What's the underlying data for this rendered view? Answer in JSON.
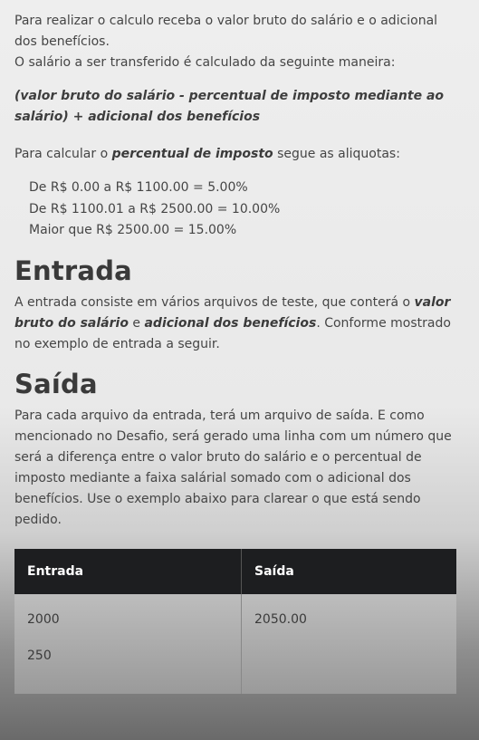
{
  "intro": {
    "line1": "Para realizar o calculo receba o valor bruto do salário e o adicional dos benefícios.",
    "line2": "O salário a ser transferido é calculado da seguinte maneira:",
    "formula": "(valor bruto do salário - percentual de imposto mediante ao salário) + adicional dos benefícios",
    "calc_prefix": "Para calcular o ",
    "calc_bold": "percentual de imposto",
    "calc_suffix": " segue as aliquotas:",
    "rates": [
      "De R$ 0.00 a R$ 1100.00 = 5.00%",
      "De R$ 1100.01 a R$ 2500.00 = 10.00%",
      "Maior que R$ 2500.00 = 15.00%"
    ]
  },
  "entrada": {
    "heading": "Entrada",
    "text_prefix": "A entrada consiste em vários arquivos de teste, que conterá o ",
    "bold1": "valor bruto do salário",
    "text_mid": " e ",
    "bold2": "adicional dos benefícios",
    "text_suffix": ". Conforme mostrado no exemplo de entrada a seguir."
  },
  "saida": {
    "heading": "Saída",
    "text": "Para cada arquivo da entrada, terá um arquivo de saída. E como mencionado no Desafio, será gerado uma linha com um número que será a diferença entre o valor bruto do salário e o percentual de imposto mediante a faixa salárial somado com o adicional dos benefícios. Use o exemplo abaixo para clarear o que está sendo pedido."
  },
  "table": {
    "headers": [
      "Entrada",
      "Saída"
    ],
    "input_values": [
      "2000",
      "250"
    ],
    "output_values": [
      "2050.00"
    ]
  }
}
